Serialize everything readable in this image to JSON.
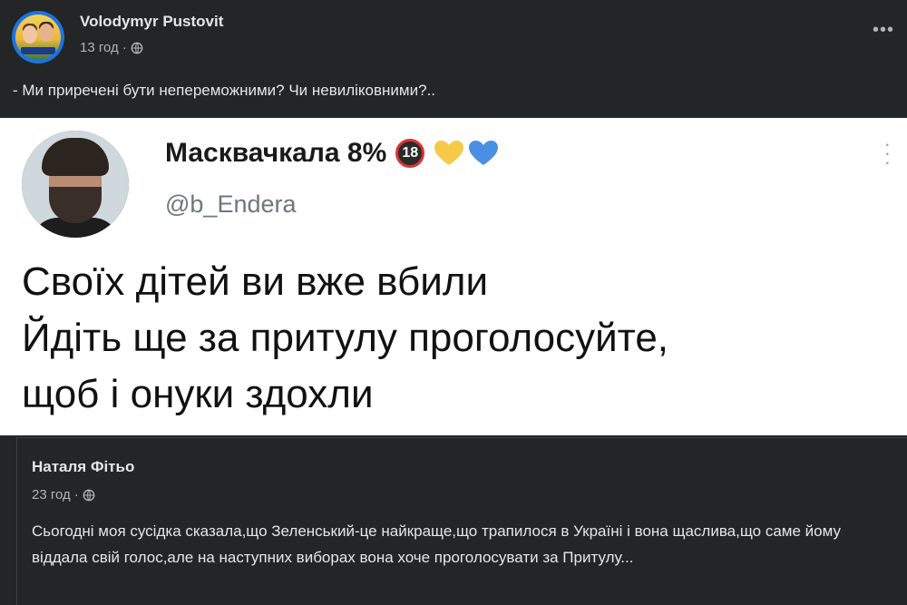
{
  "post": {
    "author": "Volodymyr Pustovit",
    "time": "13 год",
    "separator": "·",
    "text": "- Ми приречені бути непереможними? Чи невиліковними?.."
  },
  "tweet": {
    "name": "Масквачкала 8%",
    "badge": "18",
    "handle": "@b_Endera",
    "lines": [
      "Своїх дітей ви вже вбили",
      "Йдіть ще за притулу проголосуйте,",
      "щоб і онуки здохли"
    ],
    "heart_colors": [
      "#f7c948",
      "#4a90e2"
    ]
  },
  "quoted": {
    "author": "Наталя Фітьо",
    "time": "23 год",
    "separator": "·",
    "text": "Сьогодні моя сусідка сказала,що Зеленський-це найкраще,що трапилося в Україні і вона щаслива,що саме йому віддала свій голос,але на наступних виборах вона хоче проголосувати за Притулу..."
  }
}
